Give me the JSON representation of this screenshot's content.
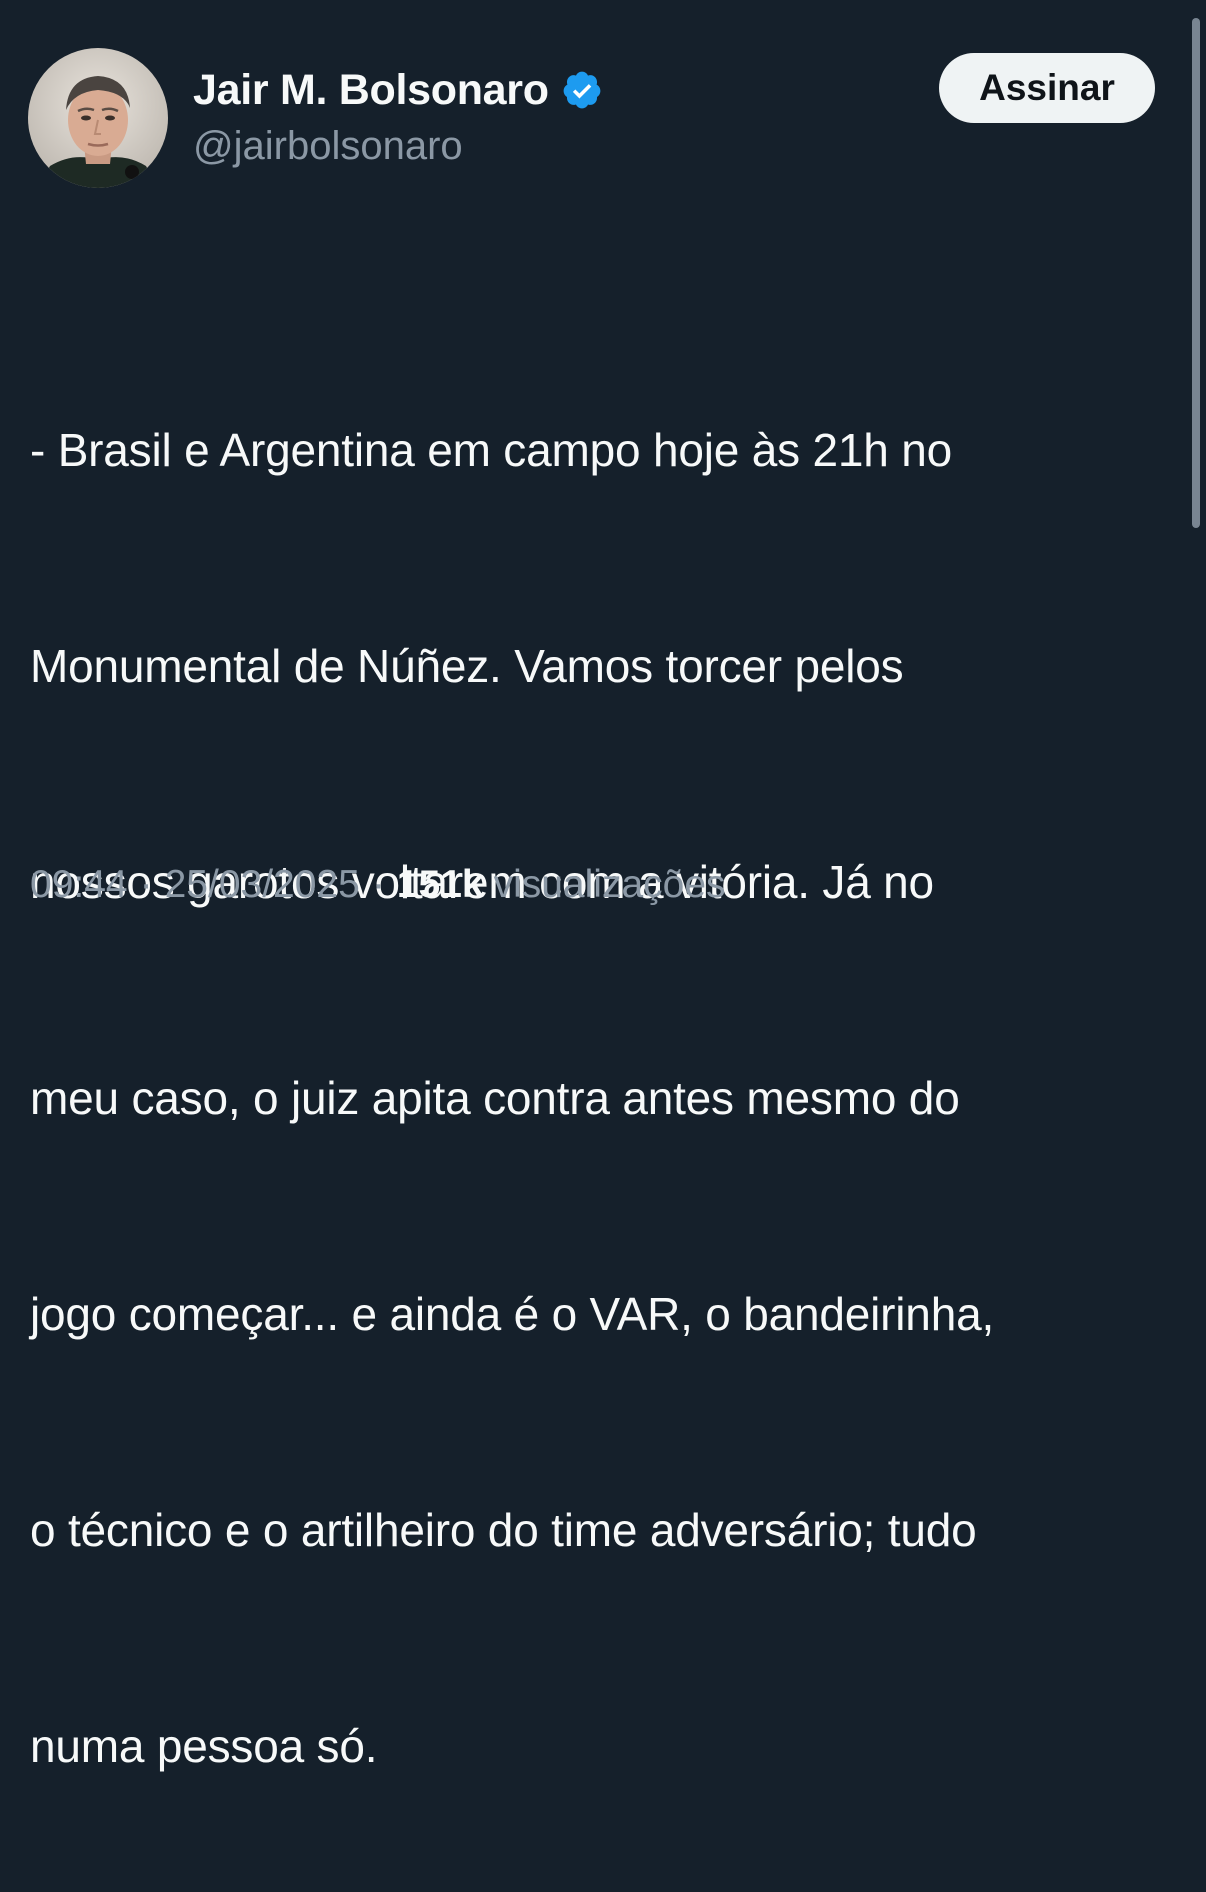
{
  "author": {
    "display_name": "Jair M. Bolsonaro",
    "handle": "@jairbolsonaro",
    "verified": true
  },
  "subscribe_button": {
    "label": "Assinar"
  },
  "tweet": {
    "lines": [
      "- Brasil e Argentina em campo hoje às 21h no",
      "Monumental de Núñez. Vamos torcer pelos",
      "nossos garotos voltarem com a vitória. Já no",
      "meu caso, o juiz apita contra antes mesmo do",
      "jogo começar... e ainda é o VAR, o bandeirinha,",
      "o técnico e o artilheiro do time adversário; tudo",
      "numa pessoa só."
    ]
  },
  "meta": {
    "time": "09:44",
    "separator": "·",
    "date": "25/03/2025",
    "views_count": "151k",
    "views_label": "visualizações"
  },
  "colors": {
    "background": "#15202b",
    "text_primary": "#f7f9f9",
    "text_secondary": "#8b98a5",
    "verified_badge": "#1d9bf0",
    "button_bg": "#eff3f4"
  },
  "icons": {
    "verified": "verified-badge-icon",
    "avatar": "profile-photo"
  }
}
